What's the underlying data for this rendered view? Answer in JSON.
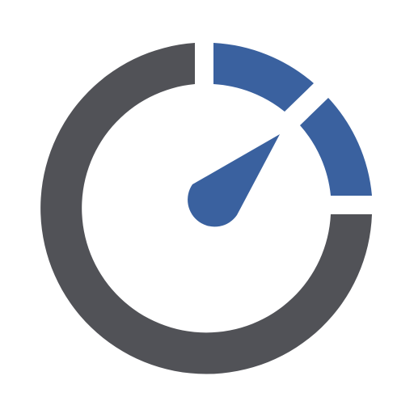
{
  "icon": {
    "name": "speedometer-gauge-icon",
    "colors": {
      "background": "#ffffff",
      "ring": "#515257",
      "accent": "#3a619f"
    }
  }
}
